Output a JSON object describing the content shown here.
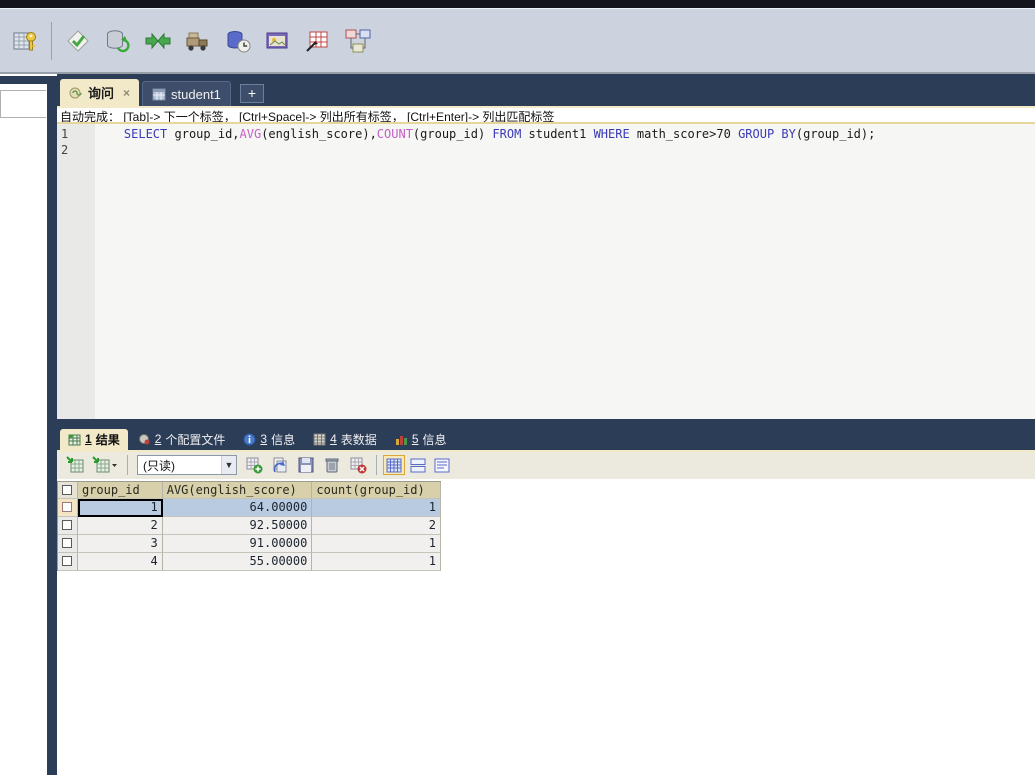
{
  "main_toolbar": {
    "icons": [
      "connection-manager",
      "query-validate",
      "database-refresh",
      "data-compare",
      "import-external-data",
      "schema-sync",
      "visual-data-compare",
      "query-builder",
      "schema-designer"
    ]
  },
  "editor_tabs": {
    "query_tab_label": "询问",
    "query_tab_close": "×",
    "table_tab_label": "student1",
    "new_tab_label": "+"
  },
  "autocomplete_hint": "自动完成： [Tab]-> 下一个标签， [Ctrl+Space]-> 列出所有标签， [Ctrl+Enter]-> 列出匹配标签",
  "sql_editor": {
    "line_numbers": [
      "1",
      "2"
    ],
    "code_tokens": [
      {
        "t": "    ",
        "c": "plain"
      },
      {
        "t": "SELECT",
        "c": "keyword"
      },
      {
        "t": " group_id,",
        "c": "plain"
      },
      {
        "t": "AVG",
        "c": "function"
      },
      {
        "t": "(english_score),",
        "c": "plain"
      },
      {
        "t": "COUNT",
        "c": "function"
      },
      {
        "t": "(group_id) ",
        "c": "plain"
      },
      {
        "t": "FROM",
        "c": "keyword"
      },
      {
        "t": " student1 ",
        "c": "plain"
      },
      {
        "t": "WHERE",
        "c": "keyword"
      },
      {
        "t": " math_score>70 ",
        "c": "plain"
      },
      {
        "t": "GROUP",
        "c": "keyword"
      },
      {
        "t": " ",
        "c": "plain"
      },
      {
        "t": "BY",
        "c": "keyword"
      },
      {
        "t": "(group_id);",
        "c": "plain"
      }
    ]
  },
  "result_tabs": [
    {
      "num": "1",
      "label": "结果",
      "active": true
    },
    {
      "num": "2",
      "label": "个配置文件",
      "active": false
    },
    {
      "num": "3",
      "label": "信息",
      "active": false
    },
    {
      "num": "4",
      "label": "表数据",
      "active": false
    },
    {
      "num": "5",
      "label": "信息",
      "active": false
    }
  ],
  "results_toolbar": {
    "mode_dropdown_value": "(只读)",
    "dropdown_arrow": "▼",
    "icons": [
      "export-result",
      "export-options",
      "insert-row",
      "refresh-rows",
      "save-changes",
      "delete-row",
      "clear-result",
      "grid-view",
      "form-view",
      "text-view"
    ],
    "selected_view": "grid-view"
  },
  "results_table": {
    "columns": [
      "group_id",
      "AVG(english_score)",
      "count(group_id)"
    ],
    "rows": [
      [
        "1",
        "64.00000",
        "1"
      ],
      [
        "2",
        "92.50000",
        "2"
      ],
      [
        "3",
        "91.00000",
        "1"
      ],
      [
        "4",
        "55.00000",
        "1"
      ]
    ],
    "selected_row_index": 0,
    "focused_cell": {
      "row": 0,
      "col": 0
    }
  },
  "colors": {
    "accent_cream": "#f2e9c9",
    "navy": "#2c3d58",
    "selection_blue": "#b9cbe0",
    "header_tan": "#d7d0ab",
    "keyword_blue": "#3a3ab8",
    "function_magenta": "#c75fc7"
  }
}
